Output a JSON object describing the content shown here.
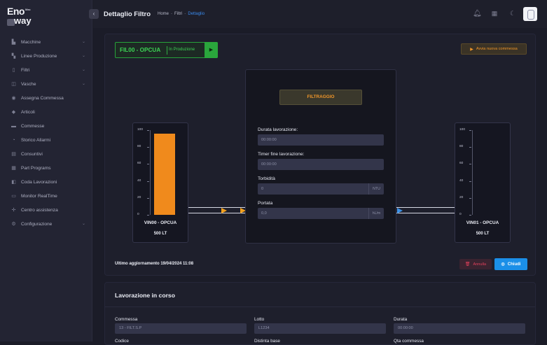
{
  "brand": {
    "line1": "Eno",
    "sup": "Mac",
    "line2": "way"
  },
  "sidebar": {
    "items": [
      {
        "label": "Macchine",
        "icon": "factory-icon",
        "glyph": "▙",
        "expandable": true
      },
      {
        "label": "Linee Produzione",
        "icon": "production-line-icon",
        "glyph": "▚",
        "expandable": true
      },
      {
        "label": "Filtri",
        "icon": "filter-icon",
        "glyph": "▯",
        "expandable": true
      },
      {
        "label": "Vasche",
        "icon": "tank-icon",
        "glyph": "◫",
        "expandable": true
      },
      {
        "label": "Assegna Commessa",
        "icon": "assign-icon",
        "glyph": "◉",
        "expandable": false
      },
      {
        "label": "Articoli",
        "icon": "tag-icon",
        "glyph": "◆",
        "expandable": false
      },
      {
        "label": "Commesse",
        "icon": "folder-icon",
        "glyph": "▬",
        "expandable": false
      },
      {
        "label": "Storico Allarmi",
        "icon": "alarm-history-icon",
        "glyph": "◔",
        "expandable": false
      },
      {
        "label": "Consuntivi",
        "icon": "report-icon",
        "glyph": "▤",
        "expandable": false
      },
      {
        "label": "Part Programs",
        "icon": "program-icon",
        "glyph": "▦",
        "expandable": false
      },
      {
        "label": "Coda Lavorazioni",
        "icon": "queue-icon",
        "glyph": "◧",
        "expandable": false
      },
      {
        "label": "Monitor RealTime",
        "icon": "monitor-icon",
        "glyph": "▭",
        "expandable": false
      },
      {
        "label": "Centro assistenza",
        "icon": "support-icon",
        "glyph": "✢",
        "expandable": false
      },
      {
        "label": "Configurazione",
        "icon": "settings-icon",
        "glyph": "⚙",
        "expandable": true
      }
    ]
  },
  "header": {
    "title": "Dettaglio Filtro",
    "breadcrumbs": [
      "Home",
      "Filtri",
      "Dettaglio"
    ]
  },
  "filter": {
    "name": "FIL00 - OPCUA",
    "state": "In Produzione",
    "start_button": "Avvia nuova commessa",
    "phase": "FILTRAGGIO",
    "fields": [
      {
        "label": "Durata lavorazione:",
        "value": "00:00:00",
        "unit": ""
      },
      {
        "label": "Timer fine lavorazione:",
        "value": "00:00:00",
        "unit": ""
      },
      {
        "label": "Torbidità",
        "value": "0",
        "unit": "NTU"
      },
      {
        "label": "Portata",
        "value": "0,0",
        "unit": "hL/m"
      }
    ]
  },
  "tanks": [
    {
      "name": "VIN00 - OPCUA",
      "capacity": "500 LT",
      "ticks": [
        "100",
        "80",
        "60",
        "40",
        "20",
        "0"
      ],
      "level_percent": 96
    },
    {
      "name": "VIN01 - OPCUA",
      "capacity": "500 LT",
      "ticks": [
        "100",
        "80",
        "60",
        "40",
        "20",
        "0"
      ],
      "level_percent": 0
    }
  ],
  "footer": {
    "last_update": "Ultimo aggiornamento 19/04/2024 11:08",
    "cancel": "Annulla",
    "close": "Chiudi"
  },
  "work": {
    "title": "Lavorazione in corso",
    "fields": [
      {
        "label": "Commessa",
        "value": "13 - FILT.S.P"
      },
      {
        "label": "Lotto",
        "value": "L1234"
      },
      {
        "label": "Durata",
        "value": "00:00:00"
      }
    ],
    "next_labels": [
      "Codice",
      "Distinta base",
      "Qta commessa"
    ]
  },
  "colors": {
    "accent": "#1b8fe8",
    "running": "#3cd254",
    "warning": "#f0962a",
    "danger": "#e3405c",
    "tank_fill": "#f08a1c"
  }
}
